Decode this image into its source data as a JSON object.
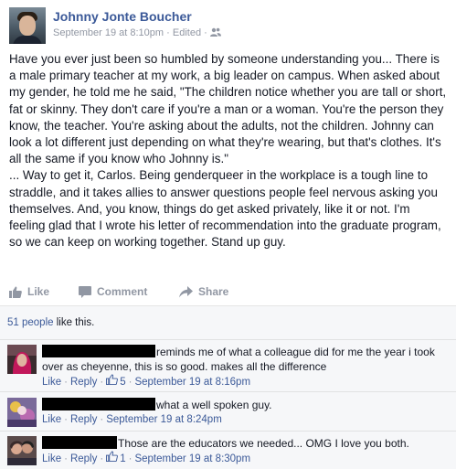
{
  "post": {
    "author": "Johnny Jonte Boucher",
    "timestamp": "September 19 at 8:10pm",
    "edited": "Edited",
    "meta_separator": "·",
    "audience_icon": "friends-icon",
    "body": "Have you ever just been so humbled by someone understanding you... There is a male primary teacher at my work, a big leader on campus. When asked about my gender, he told me he said, \"The children notice whether you are tall or short, fat or skinny. They don't care if you're a man or a woman. You're the person they know, the teacher. You're asking about the adults, not the children. Johnny can look a lot different just depending on what they're wearing, but that's clothes. It's all the same if you know who Johnny is.\"\n... Way to get it, Carlos. Being genderqueer in the workplace is a tough line to straddle, and it takes allies to answer questions people feel nervous asking you themselves. And, you know, things do get asked privately, like it or not. I'm feeling glad that I wrote his letter of recommendation into the graduate program, so we can keep on working together. Stand up guy."
  },
  "actions": {
    "like": "Like",
    "comment": "Comment",
    "share": "Share"
  },
  "likes": {
    "count_link": "51 people",
    "suffix": " like this."
  },
  "comments": [
    {
      "text": "reminds me of what a colleague did for me the year i took over as cheyenne, this is so good. makes all the difference",
      "like_label": "Like",
      "reply_label": "Reply",
      "like_count": "5",
      "timestamp": "September 19 at 8:16pm"
    },
    {
      "text": "what a well spoken guy.",
      "like_label": "Like",
      "reply_label": "Reply",
      "timestamp": "September 19 at 8:24pm"
    },
    {
      "text": "Those are the educators we needed... OMG I love you both.",
      "like_label": "Like",
      "reply_label": "Reply",
      "like_count": "1",
      "timestamp": "September 19 at 8:30pm"
    }
  ],
  "colors": {
    "link_blue": "#3b5998",
    "meta_gray": "#9197a3",
    "feedback_bg": "#f6f7f9",
    "text": "#141823"
  }
}
